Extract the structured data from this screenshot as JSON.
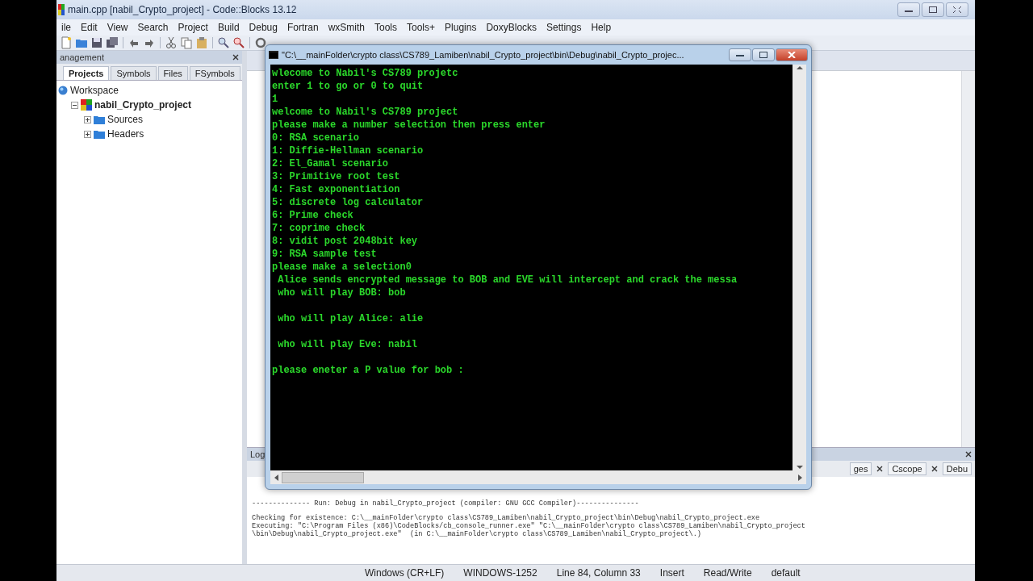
{
  "window": {
    "title": "main.cpp [nabil_Crypto_project] - Code::Blocks 13.12"
  },
  "menu": [
    "ile",
    "Edit",
    "View",
    "Search",
    "Project",
    "Build",
    "Debug",
    "Fortran",
    "wxSmith",
    "Tools",
    "Tools+",
    "Plugins",
    "DoxyBlocks",
    "Settings",
    "Help"
  ],
  "management": {
    "title": "anagement",
    "tabs": [
      {
        "label": "Projects",
        "selected": true
      },
      {
        "label": "Symbols",
        "selected": false
      },
      {
        "label": "Files",
        "selected": false
      },
      {
        "label": "FSymbols",
        "selected": false
      }
    ],
    "tree": [
      {
        "label": "Workspace",
        "kind": "workspace",
        "children": [
          {
            "label": "nabil_Crypto_project",
            "kind": "project",
            "expanded": true,
            "children": [
              {
                "label": "Sources",
                "kind": "folder",
                "expanded": false
              },
              {
                "label": "Headers",
                "kind": "folder",
                "expanded": false
              }
            ]
          }
        ]
      }
    ]
  },
  "console": {
    "title": "\"C:\\__mainFolder\\crypto class\\CS789_Lamiben\\nabil_Crypto_project\\bin\\Debug\\nabil_Crypto_projec...",
    "paragraphs": [
      [
        "wlecome to Nabil's CS789 projetc",
        "enter 1 to go or 0 to quit",
        "1",
        "welcome to Nabil's CS789 project",
        "please make a number selection then press enter",
        "0: RSA scenario",
        "1: Diffie-Hellman scenario",
        "2: El_Gamal scenario",
        "3: Primitive root test",
        "4: Fast exponentiation",
        "5: discrete log calculator",
        "6: Prime check",
        "7: coprime check",
        "8: vidit post 2048bit key",
        "9: RSA sample test",
        "please make a selection0",
        " Alice sends encrypted message to BOB and EVE will intercept and crack the messa",
        " who will play BOB: bob"
      ],
      [
        " who will play Alice: alie"
      ],
      [
        " who will play Eve: nabil"
      ],
      [
        "please eneter a P value for bob :"
      ]
    ]
  },
  "logs": {
    "title": "Log",
    "tabs": [
      {
        "label": "ges"
      },
      {
        "label": "Cscope"
      },
      {
        "label": "Debu"
      }
    ],
    "lines": [
      "-------------- Run: Debug in nabil_Crypto_project (compiler: GNU GCC Compiler)---------------",
      "Checking for existence: C:\\__mainFolder\\crypto class\\CS789_Lamiben\\nabil_Crypto_project\\bin\\Debug\\nabil_Crypto_project.exe",
      "Executing: \"C:\\Program Files (x86)\\CodeBlocks/cb_console_runner.exe\" \"C:\\__mainFolder\\crypto class\\CS789_Lamiben\\nabil_Crypto_project",
      "\\bin\\Debug\\nabil_Crypto_project.exe\"  (in C:\\__mainFolder\\crypto class\\CS789_Lamiben\\nabil_Crypto_project\\.)"
    ]
  },
  "status_bar": [
    "Windows (CR+LF)",
    "WINDOWS-1252",
    "Line 84, Column 33",
    "Insert",
    "Read/Write",
    "default"
  ]
}
